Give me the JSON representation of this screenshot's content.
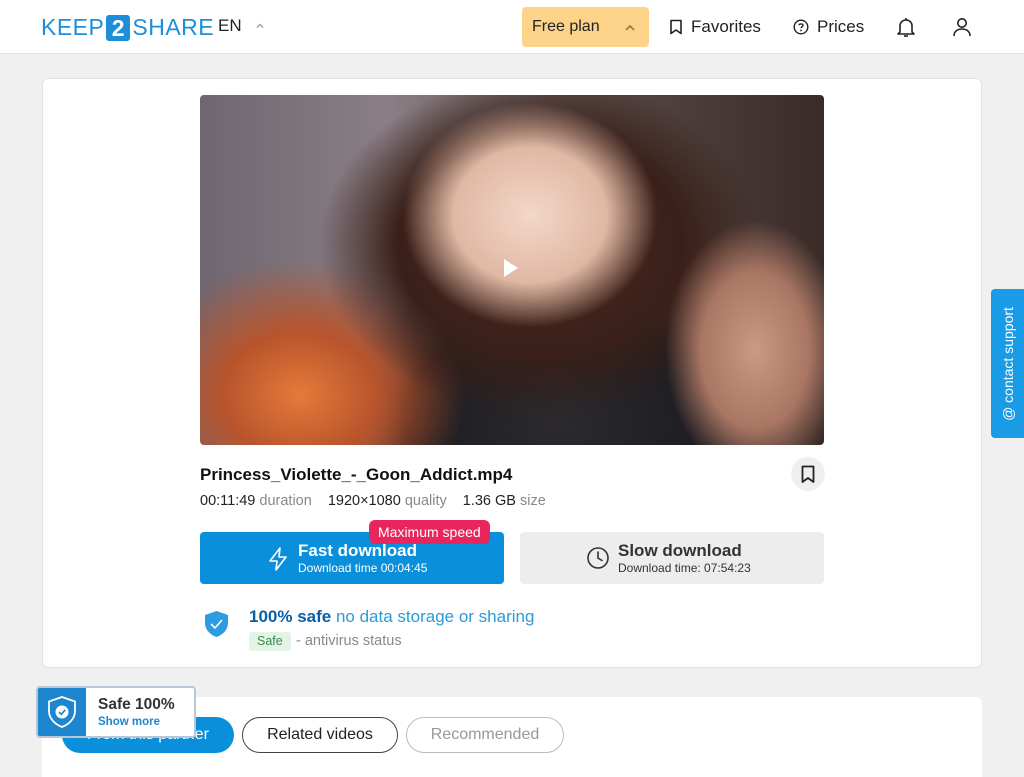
{
  "header": {
    "logo_left": "KEEP",
    "logo_num": "2",
    "logo_right": "SHARE",
    "language": "EN",
    "plan_label": "Free plan",
    "favorites_label": "Favorites",
    "prices_label": "Prices"
  },
  "file": {
    "name": "Princess_Violette_-_Goon_Addict.mp4",
    "duration_value": "00:11:49",
    "duration_label": "duration",
    "quality_value": "1920×1080",
    "quality_label": "quality",
    "size_value": "1.36 GB",
    "size_label": "size"
  },
  "download": {
    "fast_title": "Fast download",
    "fast_subtitle": "Download time 00:04:45",
    "max_speed_badge": "Maximum speed",
    "slow_title": "Slow download",
    "slow_subtitle": "Download time: 07:54:23"
  },
  "safety": {
    "bold": "100% safe",
    "rest": "no data storage or sharing",
    "tag": "Safe",
    "antivirus": "- antivirus status"
  },
  "contact_support": "@ contact support",
  "tabs": {
    "partner": "From this partner",
    "related": "Related videos",
    "recommended": "Recommended"
  },
  "safe_badge": {
    "title": "Safe 100%",
    "link": "Show more"
  },
  "colors": {
    "brand_blue": "#0a8fdb",
    "plan_yellow": "#fdd38a",
    "badge_pink": "#e8265e",
    "contact_blue": "#1a9be6"
  }
}
